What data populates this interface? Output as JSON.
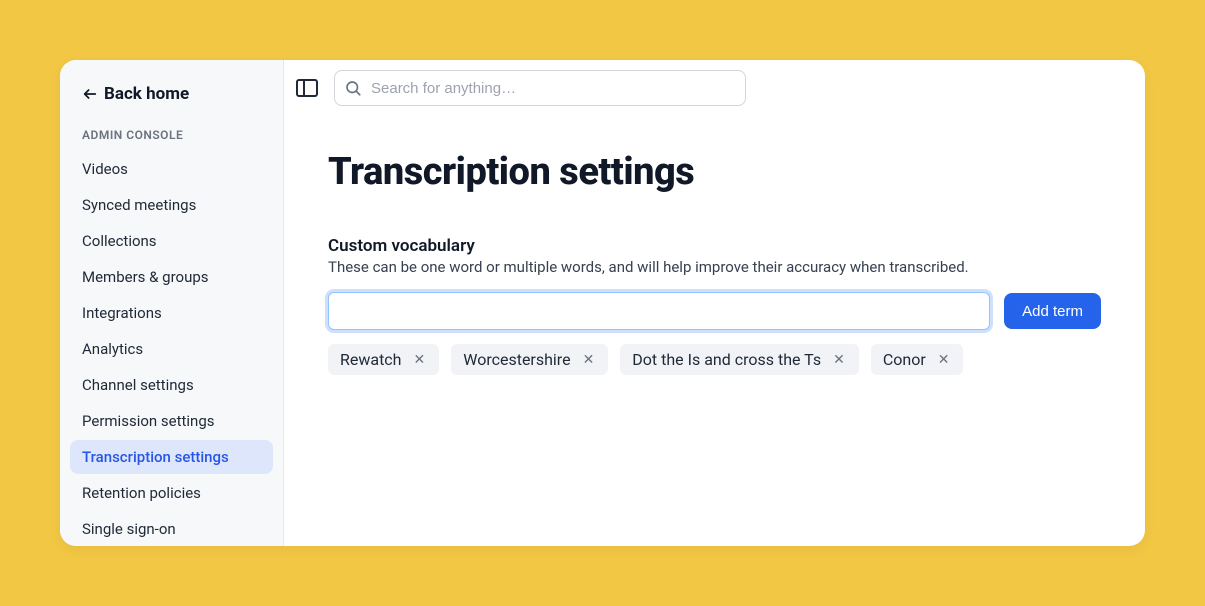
{
  "sidebar": {
    "back_label": "Back home",
    "section_label": "ADMIN CONSOLE",
    "items": [
      {
        "label": "Videos",
        "active": false
      },
      {
        "label": "Synced meetings",
        "active": false
      },
      {
        "label": "Collections",
        "active": false
      },
      {
        "label": "Members & groups",
        "active": false
      },
      {
        "label": "Integrations",
        "active": false
      },
      {
        "label": "Analytics",
        "active": false
      },
      {
        "label": "Channel settings",
        "active": false
      },
      {
        "label": "Permission settings",
        "active": false
      },
      {
        "label": "Transcription settings",
        "active": true
      },
      {
        "label": "Retention policies",
        "active": false
      },
      {
        "label": "Single sign-on",
        "active": false
      }
    ]
  },
  "topbar": {
    "search_placeholder": "Search for anything…"
  },
  "page": {
    "title": "Transcription settings",
    "vocab_label": "Custom vocabulary",
    "vocab_help": "These can be one word or multiple words, and will help improve their accuracy when transcribed.",
    "add_button": "Add term",
    "terms": [
      "Rewatch",
      "Worcestershire",
      "Dot the Is and cross the Ts",
      "Conor"
    ]
  }
}
